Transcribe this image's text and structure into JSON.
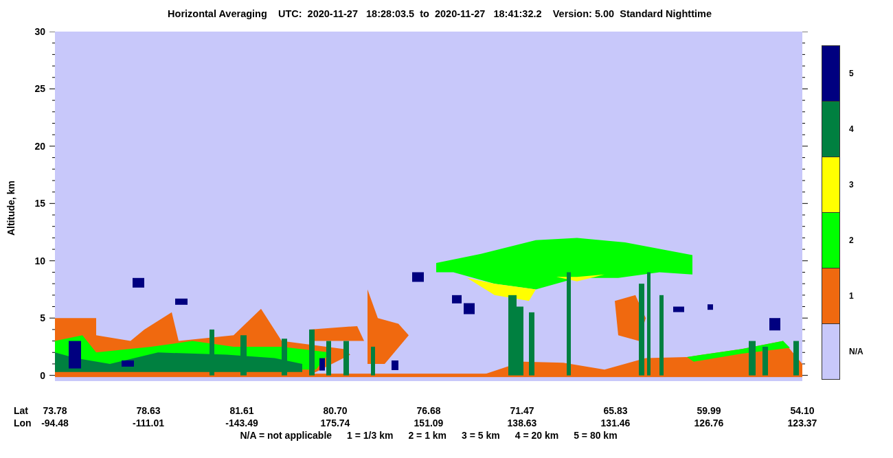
{
  "title": "Horizontal Averaging    UTC:  2020-11-27   18:28:03.5  to  2020-11-27   18:41:32.2    Version: 5.00  Standard Nighttime",
  "y_axis": {
    "label": "Altitude, km",
    "ticks": [
      "30",
      "25",
      "20",
      "15",
      "10",
      "5",
      "0"
    ]
  },
  "x_axis": {
    "row_labels": [
      "Lat",
      "Lon"
    ],
    "ticks": [
      {
        "lat": "73.78",
        "lon": "-94.48"
      },
      {
        "lat": "78.63",
        "lon": "-111.01"
      },
      {
        "lat": "81.61",
        "lon": "-143.49"
      },
      {
        "lat": "80.70",
        "lon": "175.74"
      },
      {
        "lat": "76.68",
        "lon": "151.09"
      },
      {
        "lat": "71.47",
        "lon": "138.63"
      },
      {
        "lat": "65.83",
        "lon": "131.46"
      },
      {
        "lat": "59.99",
        "lon": "126.76"
      },
      {
        "lat": "54.10",
        "lon": "123.37"
      }
    ]
  },
  "legend": [
    {
      "label": "5",
      "color": "#000080"
    },
    {
      "label": "4",
      "color": "#008040"
    },
    {
      "label": "3",
      "color": "#ffff00"
    },
    {
      "label": "2",
      "color": "#00ff00"
    },
    {
      "label": "1",
      "color": "#f0690f"
    },
    {
      "label": "N/A",
      "color": "#c8c8fa"
    }
  ],
  "footnote": [
    "N/A = not applicable",
    "1 = 1/3 km",
    "2 = 1 km",
    "3 = 5 km",
    "4 = 20 km",
    "5 = 80 km"
  ]
}
